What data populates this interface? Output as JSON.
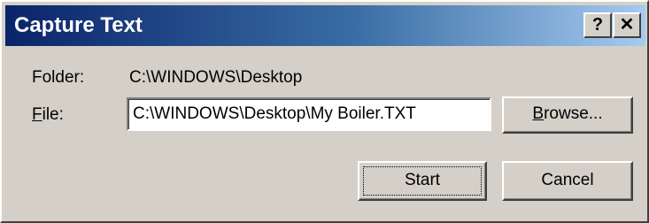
{
  "window": {
    "title": "Capture Text",
    "help_label": "?",
    "close_label": "✕"
  },
  "form": {
    "folder_label": "Folder:",
    "folder_value": "C:\\WINDOWS\\Desktop",
    "file_label_mnemonic": "F",
    "file_label_rest": "ile:",
    "file_value": "C:\\WINDOWS\\Desktop\\My Boiler.TXT"
  },
  "buttons": {
    "browse_mnemonic": "B",
    "browse_rest": "rowse...",
    "start": "Start",
    "cancel": "Cancel"
  },
  "colors": {
    "titlebar_start": "#0a246a",
    "titlebar_end": "#a6caf0",
    "face": "#d4d0c8"
  }
}
